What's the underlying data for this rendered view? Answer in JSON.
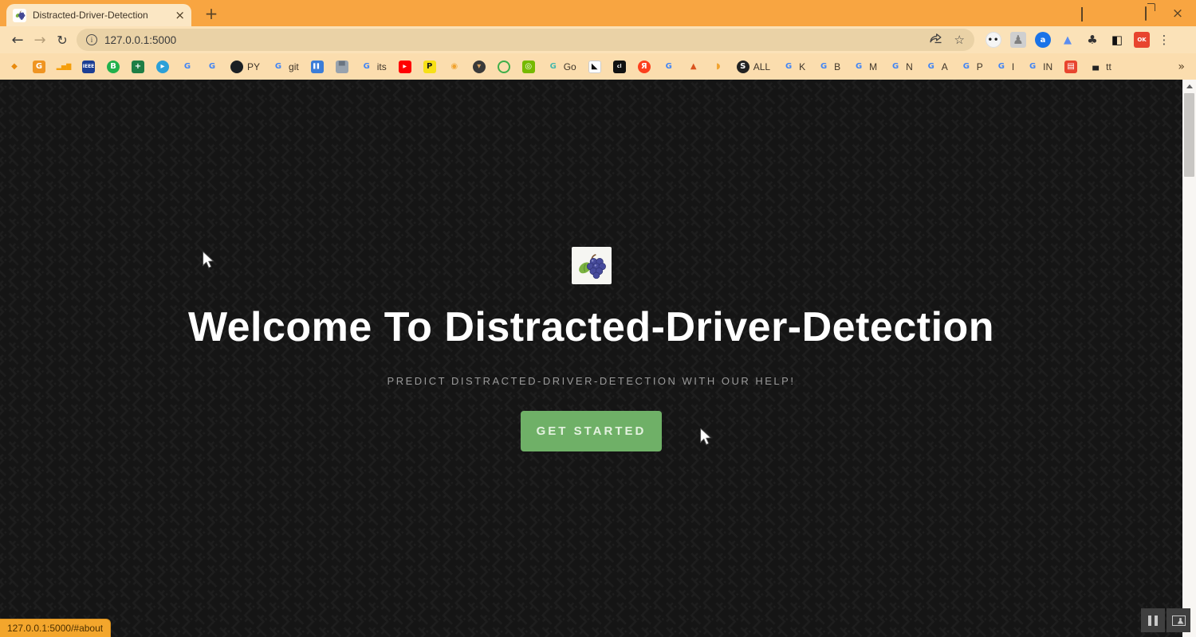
{
  "browser": {
    "tab_title": "Distracted-Driver-Detection",
    "tab_close_glyph": "×",
    "new_tab_glyph": "+",
    "url": "127.0.0.1:5000",
    "menu_dots_glyph": "⋮",
    "star_glyph": "☆",
    "back_glyph": "←",
    "forward_glyph": "→",
    "reload_glyph": "↻",
    "info_glyph": "i",
    "window_controls": [
      "tab-search-chevron",
      "minimize",
      "restore",
      "close"
    ],
    "bookmarks_overflow_glyph": "»",
    "extensions": [
      {
        "name": "panda-extension-icon",
        "shape": "circle",
        "bg": "#f5f5f5",
        "fg": "#222222",
        "glyph": "••"
      },
      {
        "name": "person-extension-icon",
        "shape": "square",
        "bg": "#cfcfcf",
        "fg": "#808080",
        "glyph": "♟"
      },
      {
        "name": "a-circle-extension-icon",
        "shape": "circle",
        "bg": "#1a73e8",
        "fg": "#ffffff",
        "glyph": "a"
      },
      {
        "name": "histogram-extension-icon",
        "shape": "bare",
        "bg": "",
        "fg": "#5b8def",
        "glyph": "▲"
      },
      {
        "name": "puzzle-extensions-icon",
        "shape": "bare",
        "bg": "",
        "fg": "#333333",
        "glyph": "♣"
      },
      {
        "name": "dark-reader-extension-icon",
        "shape": "bare",
        "bg": "",
        "fg": "#111111",
        "glyph": "◧"
      },
      {
        "name": "okok-extension-icon",
        "shape": "square",
        "bg": "#e8442e",
        "fg": "#ffffff",
        "glyph": "OK"
      }
    ],
    "bookmarks": [
      {
        "name": "play-logo-bookmark",
        "shape": "bare",
        "bg": "",
        "fg": "#e8890c",
        "glyph": "◆",
        "label": ""
      },
      {
        "name": "orange-box-bookmark",
        "shape": "square",
        "bg": "#ef9422",
        "fg": "#ffffff",
        "glyph": "G",
        "label": ""
      },
      {
        "name": "bar-chart-bookmark",
        "shape": "bare",
        "bg": "",
        "fg": "#f59e0b",
        "glyph": "▂▅▇",
        "label": ""
      },
      {
        "name": "ieee-bookmark",
        "shape": "square",
        "bg": "#1c3e94",
        "fg": "#ffffff",
        "glyph": "IEEE",
        "label": "",
        "tiny": true
      },
      {
        "name": "green-b-bookmark",
        "shape": "circle",
        "bg": "#22b14c",
        "fg": "#ffffff",
        "glyph": "B",
        "label": ""
      },
      {
        "name": "sheets-bookmark",
        "shape": "square",
        "bg": "#1e7e45",
        "fg": "#ffffff",
        "glyph": "+",
        "label": ""
      },
      {
        "name": "telegram-bookmark",
        "shape": "circle",
        "bg": "#2ba0d8",
        "fg": "#ffffff",
        "glyph": "▸",
        "label": ""
      },
      {
        "name": "google-bookmark",
        "shape": "bare",
        "bg": "",
        "fg": "#4285f4",
        "glyph": "G",
        "label": ""
      },
      {
        "name": "google-bookmark",
        "shape": "bare",
        "bg": "",
        "fg": "#4285f4",
        "glyph": "G",
        "label": ""
      },
      {
        "name": "github-py-bookmark",
        "shape": "circle",
        "bg": "#1b1f23",
        "fg": "#ffffff",
        "glyph": "",
        "label": "PY"
      },
      {
        "name": "google-git-bookmark",
        "shape": "bare",
        "bg": "",
        "fg": "#4285f4",
        "glyph": "G",
        "label": "git"
      },
      {
        "name": "blue-banner-bookmark",
        "shape": "square",
        "bg": "#3b7dd8",
        "fg": "#ffffff",
        "glyph": "▌▌",
        "label": "",
        "tiny": true
      },
      {
        "name": "briefcase-bookmark",
        "shape": "square",
        "bg": "#98a2ad",
        "fg": "#6a7480",
        "glyph": "▀",
        "label": ""
      },
      {
        "name": "google-its-bookmark",
        "shape": "bare",
        "bg": "",
        "fg": "#4285f4",
        "glyph": "G",
        "label": "its"
      },
      {
        "name": "youtube-bookmark",
        "shape": "square",
        "bg": "#ff0000",
        "fg": "#ffffff",
        "glyph": "▶",
        "label": "",
        "tiny": true
      },
      {
        "name": "p-yellow-bookmark",
        "shape": "square",
        "bg": "#f7e017",
        "fg": "#1a1a1a",
        "glyph": "P",
        "label": ""
      },
      {
        "name": "camera-bookmark",
        "shape": "bare",
        "bg": "",
        "fg": "#f0a22e",
        "glyph": "◉",
        "label": ""
      },
      {
        "name": "cart-dark-bookmark",
        "shape": "circle",
        "bg": "#3a3a3a",
        "fg": "#d9a25f",
        "glyph": "▾",
        "label": ""
      },
      {
        "name": "green-ring-bookmark",
        "shape": "ring",
        "bg": "",
        "fg": "#3fae49",
        "glyph": "",
        "label": ""
      },
      {
        "name": "nvidia-bookmark",
        "shape": "square",
        "bg": "#76b900",
        "fg": "#ffffff",
        "glyph": "◎",
        "label": ""
      },
      {
        "name": "go-teal-bookmark",
        "shape": "bare",
        "bg": "",
        "fg": "#45b8ac",
        "glyph": "G",
        "label": "Go"
      },
      {
        "name": "bird-bookmark",
        "shape": "square",
        "bg": "#ffffff",
        "fg": "#111111",
        "glyph": "◣",
        "label": ""
      },
      {
        "name": "cl-bookmark",
        "shape": "square",
        "bg": "#111111",
        "fg": "#ffffff",
        "glyph": "cl",
        "label": "",
        "tiny": true
      },
      {
        "name": "yandex-bookmark",
        "shape": "circle",
        "bg": "#fc3f1d",
        "fg": "#ffffff",
        "glyph": "Я",
        "label": ""
      },
      {
        "name": "google-bookmark",
        "shape": "bare",
        "bg": "",
        "fg": "#4285f4",
        "glyph": "G",
        "label": ""
      },
      {
        "name": "matlab-bookmark",
        "shape": "bare",
        "bg": "",
        "fg": "#d9531e",
        "glyph": "▲",
        "label": ""
      },
      {
        "name": "hand-bookmark",
        "shape": "bare",
        "bg": "",
        "fg": "#f0a22e",
        "glyph": "◗",
        "label": ""
      },
      {
        "name": "s-all-bookmark",
        "shape": "circle",
        "bg": "#222222",
        "fg": "#ffffff",
        "glyph": "S",
        "label": "ALL"
      },
      {
        "name": "google-k-bookmark",
        "shape": "bare",
        "bg": "",
        "fg": "#4285f4",
        "glyph": "G",
        "label": "K"
      },
      {
        "name": "google-b-bookmark",
        "shape": "bare",
        "bg": "",
        "fg": "#4285f4",
        "glyph": "G",
        "label": "B"
      },
      {
        "name": "google-m-bookmark",
        "shape": "bare",
        "bg": "",
        "fg": "#4285f4",
        "glyph": "G",
        "label": "M"
      },
      {
        "name": "google-n-bookmark",
        "shape": "bare",
        "bg": "",
        "fg": "#4285f4",
        "glyph": "G",
        "label": "N"
      },
      {
        "name": "google-a-bookmark",
        "shape": "bare",
        "bg": "",
        "fg": "#4285f4",
        "glyph": "G",
        "label": "A"
      },
      {
        "name": "google-p-bookmark",
        "shape": "bare",
        "bg": "",
        "fg": "#4285f4",
        "glyph": "G",
        "label": "P"
      },
      {
        "name": "google-i-bookmark",
        "shape": "bare",
        "bg": "",
        "fg": "#4285f4",
        "glyph": "G",
        "label": "I"
      },
      {
        "name": "google-in-bookmark",
        "shape": "bare",
        "bg": "",
        "fg": "#4285f4",
        "glyph": "G",
        "label": "IN"
      },
      {
        "name": "red-badge-bookmark",
        "shape": "square",
        "bg": "#e8442e",
        "fg": "#ffffff",
        "glyph": "▤",
        "label": ""
      },
      {
        "name": "bus-tt-bookmark",
        "shape": "bare",
        "bg": "",
        "fg": "#222222",
        "glyph": "▄",
        "label": "tt"
      }
    ]
  },
  "page": {
    "heading": "Welcome To Distracted-Driver-Detection",
    "subtitle": "PREDICT DISTRACTED-DRIVER-DETECTION WITH OUR HELP!",
    "cta_label": "GET STARTED",
    "status_link": "127.0.0.1:5000/#about",
    "logo": "grapes-logo"
  },
  "colors": {
    "frame_orange": "#f8a541",
    "toolbar_cream": "#fbe2b8",
    "omnibox_tan": "#ead2a6",
    "bookmarks_cream": "#fbddae",
    "page_bg": "#161616",
    "cta_green": "#6fb067",
    "status_orange": "#f3a62c",
    "heading_white": "#ffffff",
    "subtitle_gray": "#9a9a9a"
  }
}
